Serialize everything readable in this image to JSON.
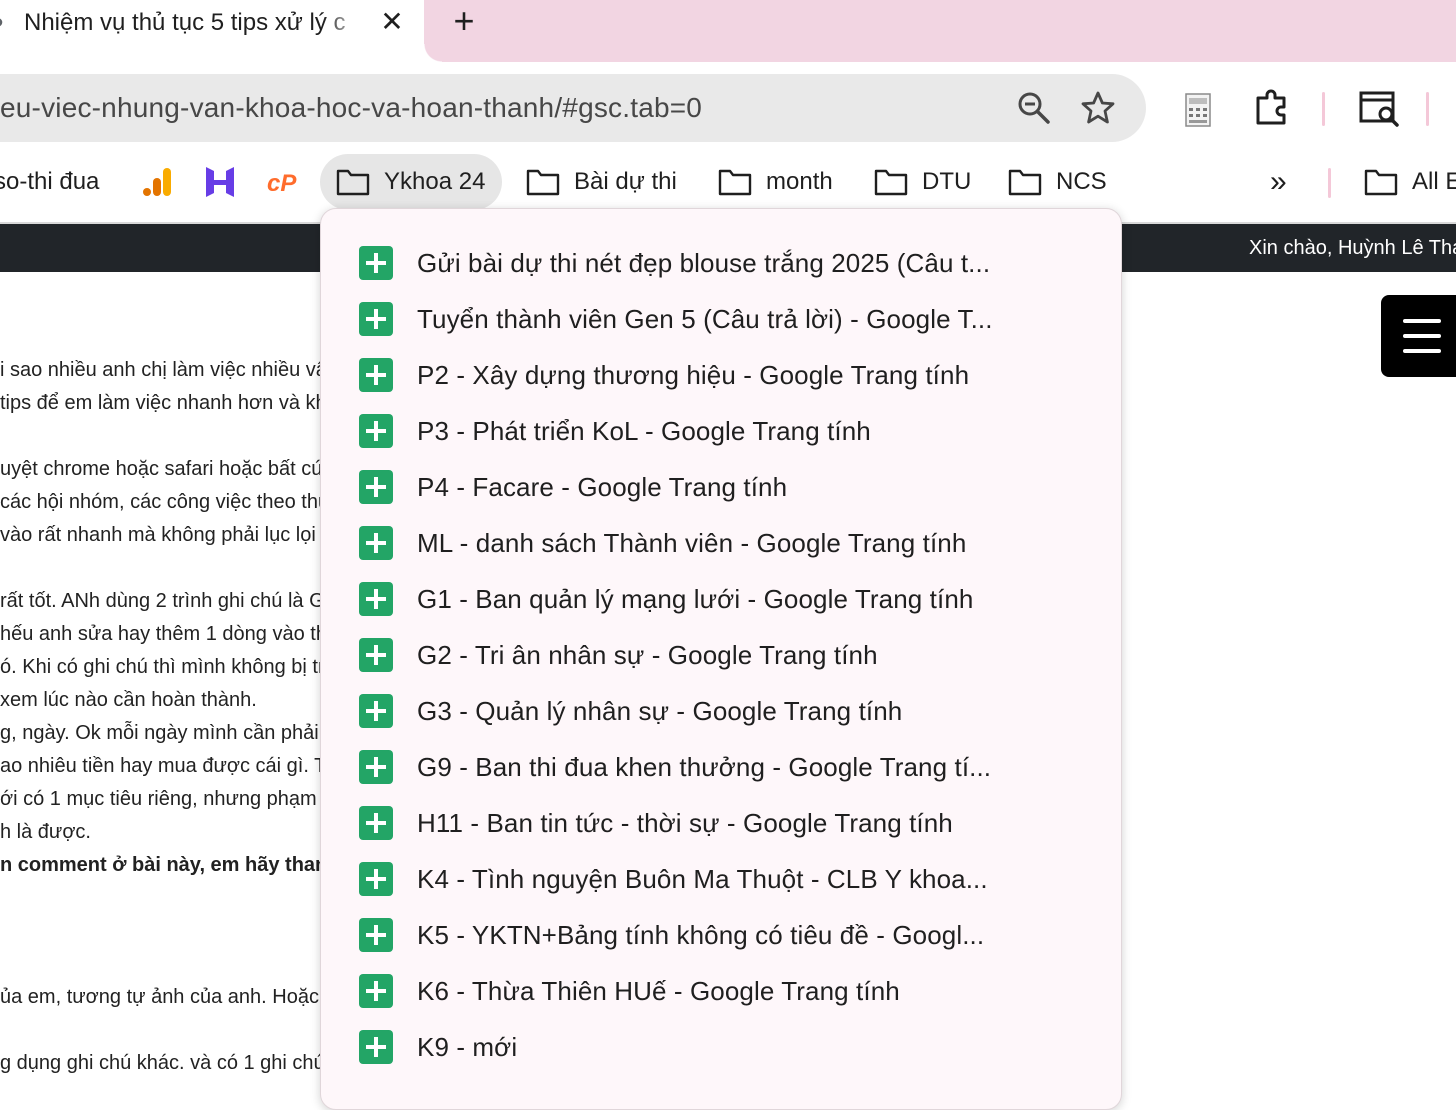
{
  "tab": {
    "title": "Nhiệm vụ thủ tục 5 tips xử lý c",
    "close": "✕",
    "new_tab": "+"
  },
  "toolbar": {
    "url": "eu-viec-nhung-van-khoa-hoc-va-hoan-thanh/#gsc.tab=0"
  },
  "bookmarks": {
    "items": [
      {
        "label": "so-thi đua",
        "icon": "none"
      },
      {
        "label": "",
        "icon": "analytics-icon"
      },
      {
        "label": "",
        "icon": "hostinger-icon"
      },
      {
        "label": "",
        "icon": "cpanel-icon"
      },
      {
        "label": "Ykhoa 24",
        "icon": "folder-icon",
        "active": true
      },
      {
        "label": "Bài dự thi",
        "icon": "folder-icon"
      },
      {
        "label": "month",
        "icon": "folder-icon"
      },
      {
        "label": "DTU",
        "icon": "folder-icon"
      },
      {
        "label": "NCS",
        "icon": "folder-icon"
      }
    ],
    "overflow": "»",
    "all_bookmarks": "All E"
  },
  "page": {
    "greeting": "Xin chào, Huỳnh Lê Tha",
    "article_lines": [
      "i sao nhiều anh chị làm việc nhiều vậ",
      "tips để em làm việc nhanh hơn và kh",
      "uyệt chrome hoặc safari hoặc bất cứ",
      " các hội nhóm, các công việc theo thu",
      "vào rất nhanh mà không phải lục lọi x",
      " rất tốt. ANh dùng 2 trình ghi chú là G",
      "hếu anh sửa hay thêm 1 dòng vào thì",
      "ó. Khi có ghi chú thì mình không bị tr",
      "xem lúc nào cần hoàn thành.",
      "g, ngày. Ok mỗi ngày mình cần phải h",
      "ao nhiêu tiền hay mua được cái gì. Tù",
      "ới có 1 mục tiêu riêng, nhưng phạm vi",
      "h là được.",
      "n comment ở bài này, em hãy than",
      "ủa em, tương tự ảnh của anh. Hoặc e",
      "g dụng ghi chú khác. và có 1 ghi chú"
    ]
  },
  "dropdown": {
    "items": [
      "Gửi bài dự thi nét đẹp blouse trắng 2025 (Câu t...",
      "Tuyển thành viên Gen 5 (Câu trả lời) - Google T...",
      "P2 - Xây dựng thương hiệu - Google Trang tính",
      "P3 - Phát triển KoL - Google Trang tính",
      "P4 - Facare - Google Trang tính",
      "ML - danh sách Thành viên  - Google Trang tính",
      "G1 - Ban quản lý mạng lưới - Google Trang tính",
      "G2 - Tri ân nhân sự - Google Trang tính",
      "G3 - Quản lý nhân sự - Google Trang tính",
      "G9 - Ban thi đua khen thưởng - Google Trang tí...",
      "H11 - Ban tin tức - thời sự - Google Trang tính",
      "K4 - Tình nguyện Buôn Ma Thuột - CLB Y khoa...",
      "K5 - YKTN+Bảng tính không có tiêu đề - Googl...",
      "K6 - Thừa Thiên HUế - Google Trang tính",
      "K9 - mới"
    ]
  },
  "colors": {
    "tabstrip": "#f2d5e2",
    "sheets_green": "#23a566",
    "header_dark": "#212529",
    "dropdown_bg": "#fef7fa"
  }
}
